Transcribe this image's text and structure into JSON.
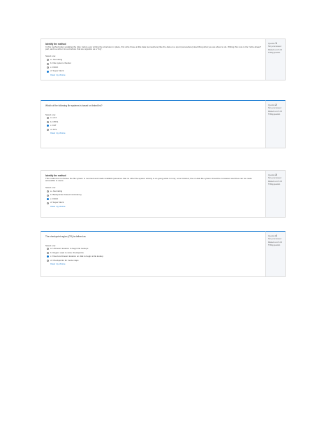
{
  "questions": [
    {
      "number": "1",
      "status": "Not yet answered",
      "marks": "Marked out of 1.00",
      "flag": "Flag question",
      "title": "Identify the method",
      "text": "In this method when updating the disk, before ever writing the structures in place, first write those a little data (somewhere) like the data on a spot (somewhere) describing what you are about to do. Writing this note is the \"write ahead\" part, and we write it to a structure that we organize as a \"log\".",
      "prompt": "Select one:",
      "options": [
        {
          "letter": "a.",
          "text": "Journaling",
          "selected": false
        },
        {
          "letter": "b.",
          "text": "File system checker",
          "selected": false
        },
        {
          "letter": "c.",
          "text": "FSCK",
          "selected": false
        },
        {
          "letter": "d.",
          "text": "Super block",
          "selected": true
        }
      ],
      "clear": "Clear my choice"
    },
    {
      "number": "2",
      "status": "Not yet answered",
      "marks": "Marked out of 1.00",
      "flag": "Flag question",
      "title": "",
      "text": "Which of the following file systems is based on linked list?",
      "prompt": "Select one:",
      "options": [
        {
          "letter": "a.",
          "text": "ext4",
          "selected": false
        },
        {
          "letter": "b.",
          "text": "NTFS",
          "selected": false
        },
        {
          "letter": "c.",
          "text": "FAT",
          "selected": true
        },
        {
          "letter": "d.",
          "text": "XFS",
          "selected": false
        }
      ],
      "clear": "Clear my choice"
    },
    {
      "number": "3",
      "status": "Not yet answered",
      "marks": "Marked out of 1.00",
      "flag": "Flag question",
      "title": "Identify the method",
      "text": "This method is run before the file system is mounted and made available (assumes that no other file-system activity is on-going while it runs); once finished, the on-disk file system should be consistent and thus can be made accessible to users.",
      "prompt": "Select one:",
      "options": [
        {
          "letter": "a.",
          "text": "Journaling",
          "selected": false
        },
        {
          "letter": "b.",
          "text": "Backpointer-based consistency",
          "selected": false
        },
        {
          "letter": "c.",
          "text": "FSCK",
          "selected": true
        },
        {
          "letter": "d.",
          "text": "Super block",
          "selected": false
        }
      ],
      "clear": "Clear my choice"
    },
    {
      "number": "4",
      "status": "Not yet answered",
      "marks": "Marked out of 1.00",
      "flag": "Flag question",
      "title": "",
      "text": "The checkpoint region (CR) is defined as",
      "prompt": "Select one:",
      "options": [
        {
          "letter": "a.",
          "text": "Unknown location to begin file lookups",
          "selected": false
        },
        {
          "letter": "b.",
          "text": "Region used to store checkpoints",
          "selected": false
        },
        {
          "letter": "c.",
          "text": "Fixed and known location on disk to begin a file lookup",
          "selected": true
        },
        {
          "letter": "d.",
          "text": "Checkpoints for inode maps",
          "selected": false
        }
      ],
      "clear": "Clear my choice"
    }
  ]
}
